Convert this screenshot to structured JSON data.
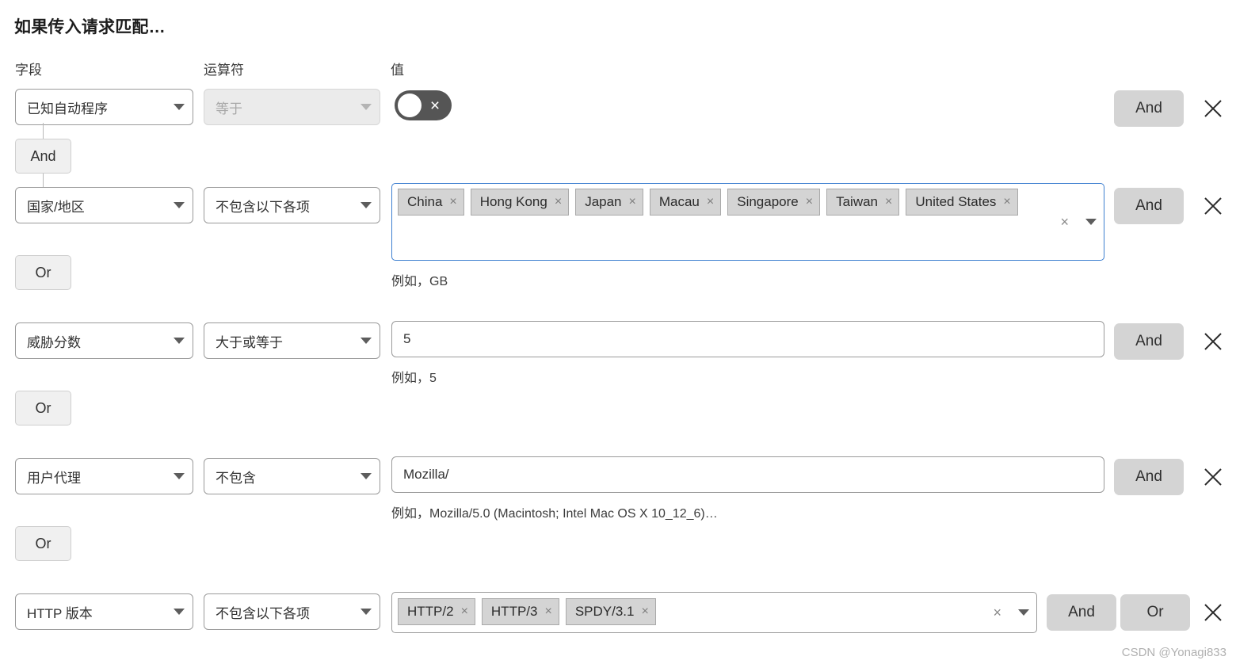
{
  "header": {
    "title": "如果传入请求匹配…",
    "columns": {
      "field": "字段",
      "operator": "运算符",
      "value": "值"
    }
  },
  "labels": {
    "and": "And",
    "or": "Or",
    "remove_icon": "×",
    "clear_icon": "×",
    "toggle_off_icon": "×"
  },
  "rows": [
    {
      "field": "已知自动程序",
      "operator": "等于",
      "operator_disabled": true,
      "value_type": "toggle",
      "toggle_state": "off",
      "hint": "",
      "and_label": "And",
      "or_label": "",
      "connector_below": "And"
    },
    {
      "field": "国家/地区",
      "operator": "不包含以下各项",
      "operator_disabled": false,
      "value_type": "multiselect",
      "tags": [
        "China",
        "Hong Kong",
        "Japan",
        "Macau",
        "Singapore",
        "Taiwan",
        "United States"
      ],
      "focused": true,
      "hint": "例如，GB",
      "and_label": "And",
      "or_label": "",
      "connector_below": "Or"
    },
    {
      "field": "威胁分数",
      "operator": "大于或等于",
      "operator_disabled": false,
      "value_type": "text",
      "value": "5",
      "hint": "例如，5",
      "and_label": "And",
      "or_label": "",
      "connector_below": "Or"
    },
    {
      "field": "用户代理",
      "operator": "不包含",
      "operator_disabled": false,
      "value_type": "text",
      "value": "Mozilla/",
      "hint": "例如，Mozilla/5.0 (Macintosh; Intel Mac OS X 10_12_6)…",
      "and_label": "And",
      "or_label": "",
      "connector_below": "Or"
    },
    {
      "field": "HTTP 版本",
      "operator": "不包含以下各项",
      "operator_disabled": false,
      "value_type": "multiselect",
      "tags": [
        "HTTP/2",
        "HTTP/3",
        "SPDY/3.1"
      ],
      "focused": false,
      "hint": "",
      "and_label": "And",
      "or_label": "Or",
      "connector_below": ""
    }
  ],
  "watermark": "CSDN @Yonagi833"
}
